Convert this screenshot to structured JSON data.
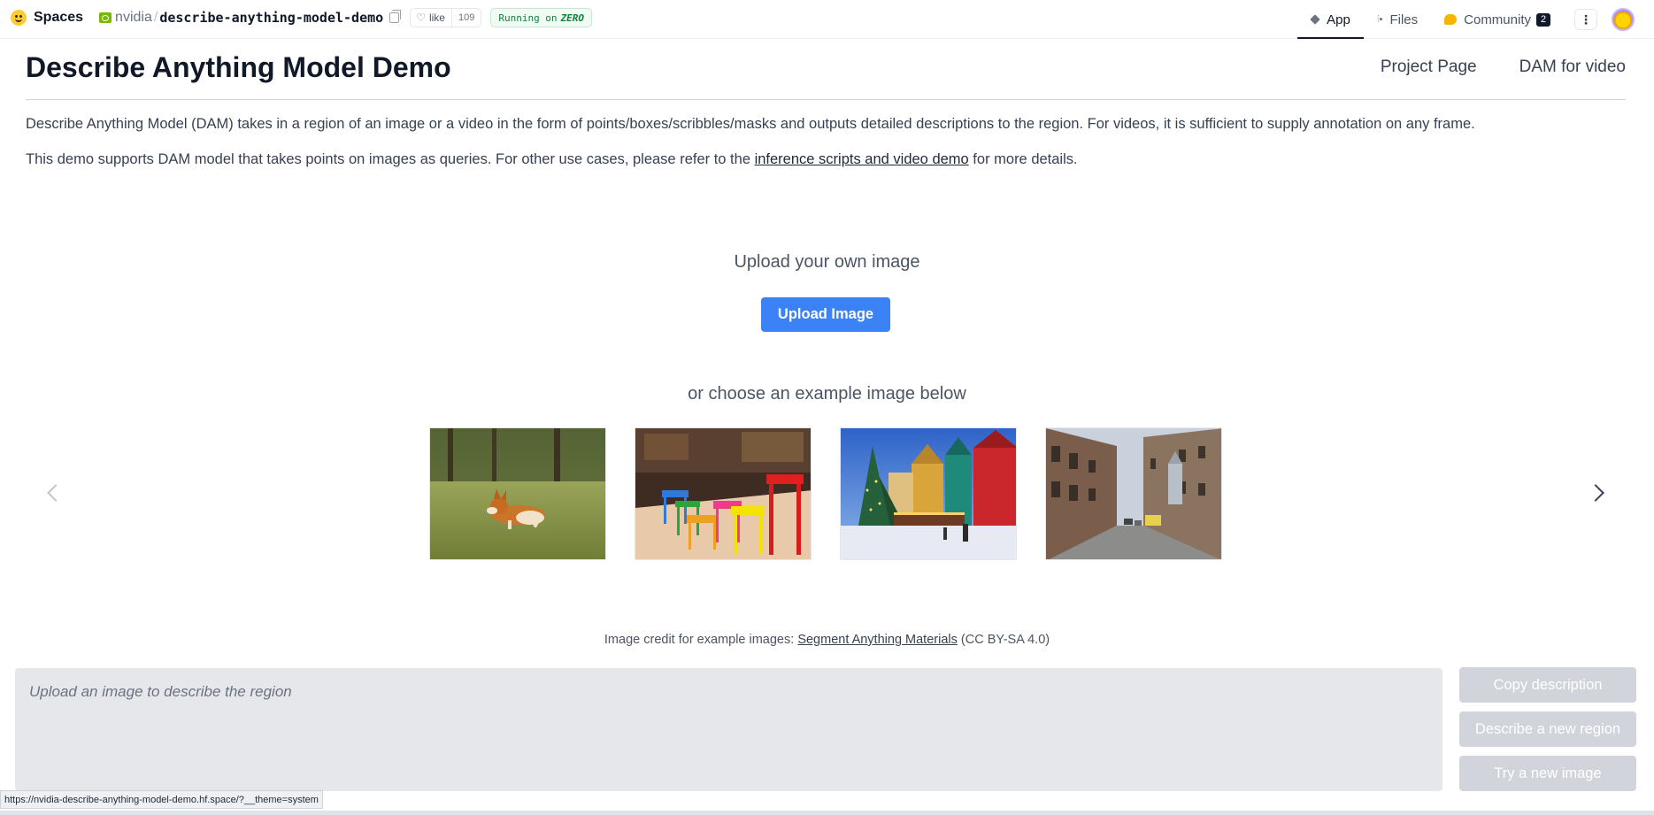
{
  "topbar": {
    "spaces_label": "Spaces",
    "org": "nvidia",
    "separator": "/",
    "repo": "describe-anything-model-demo",
    "like_label": "like",
    "like_count": "109",
    "running_prefix": "Running on",
    "running_hw": "ZERO",
    "tabs": [
      {
        "label": "App",
        "icon": "cube-icon",
        "active": true
      },
      {
        "label": "Files",
        "icon": "files-icon",
        "active": false
      },
      {
        "label": "Community",
        "icon": "community-icon",
        "active": false
      }
    ],
    "community_count": "2",
    "more_label": "⋮"
  },
  "header": {
    "title": "Describe Anything Model Demo",
    "links": [
      "Project Page",
      "DAM for video"
    ]
  },
  "intro": {
    "line1": "Describe Anything Model (DAM) takes in a region of an image or a video in the form of points/boxes/scribbles/masks and outputs detailed descriptions to the region. For videos, it is sufficient to supply annotation on any frame.",
    "line2_before": "This demo supports DAM model that takes points on images as queries. For other use cases, please refer to the ",
    "line2_link": "inference scripts and video demo",
    "line2_after": " for more details."
  },
  "upload": {
    "heading": "Upload your own image",
    "button_label": "Upload Image",
    "example_heading": "or choose an example image below"
  },
  "examples": [
    {
      "subject": "corgi running on grass"
    },
    {
      "subject": "colorful stools in a bar"
    },
    {
      "subject": "christmas tree in old town square"
    },
    {
      "subject": "city street with tram"
    }
  ],
  "credit": {
    "prefix": "Image credit for example images: ",
    "link": "Segment Anything Materials",
    "suffix": " (CC BY-SA 4.0)"
  },
  "output": {
    "placeholder": "Upload an image to describe the region",
    "buttons": [
      "Copy description",
      "Describe a new region",
      "Try a new image"
    ]
  },
  "status_bar": {
    "url": "https://nvidia-describe-anything-model-demo.hf.space/?__theme=system"
  },
  "colors": {
    "primary_button": "#3b82f6",
    "disabled_button": "#d1d5db",
    "output_bg": "#e5e7eb",
    "running_badge": "#15803d"
  }
}
